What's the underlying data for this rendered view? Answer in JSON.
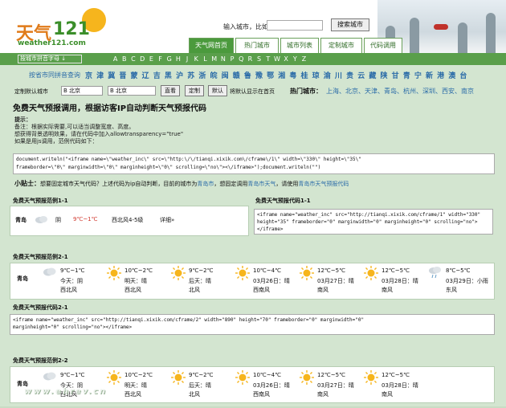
{
  "logo": {
    "cn": "天气",
    "num": "121",
    "url": "weather121.com"
  },
  "search": {
    "label": "输入城市，比如 北京",
    "button": "搜索城市"
  },
  "tabs": [
    "天气网首页",
    "热门城市",
    "城市列表",
    "定制城市",
    "代码调用"
  ],
  "letterbar": {
    "select_label": "按城市拼音字母 ↓",
    "letters": [
      "A",
      "B",
      "C",
      "D",
      "E",
      "F",
      "G",
      "H",
      "J",
      "K",
      "L",
      "M",
      "N",
      "P",
      "Q",
      "R",
      "S",
      "T",
      "W",
      "X",
      "Y",
      "Z"
    ]
  },
  "provinces": {
    "label": "按省市同拼音查询",
    "items": "京 津 冀 晋 蒙 辽 吉 黑 沪 苏 浙 皖 闽 赣 鲁 豫 鄂 湘 粤 桂 琼 渝 川 贵 云 藏 陕 甘 青 宁 新 港 澳 台"
  },
  "settings": {
    "label": "定制默认城市",
    "sel1": "B 北京",
    "sel2": "B 北京",
    "btn_go": "直看",
    "btn_custom": "定制",
    "btn_default": "默认",
    "note": "将默认显示在首页",
    "hot_label": "热门城市：",
    "hot_cities": "上海、北京、天津、青岛、杭州、深圳、西安、南京"
  },
  "main_title": "免费天气预报调用，根据访客IP自动判断天气预报代码",
  "tips": {
    "heading": "提示：",
    "line1": "备注：根据实际需要,可以适当调整宽度、高度。",
    "line2": "想获得背景透明效果，请在代码中加入allowtransparency=\"true\"",
    "line3": "如果是用js调用，范例代码如下："
  },
  "code_main": {
    "line1": "document.writeln(\"<iframe name=\\\"weather_inc\\\" src=\\\"http:\\/\\/tianqi.xixik.com\\/cframe\\/1\\\" width=\\\"330\\\" height=\\\"35\\\"",
    "line2": "frameborder=\\\"0\\\" marginwidth=\\\"0\\\" marginheight=\\\"0\\\" scrolling=\\\"no\\\"><\\/iframe>\");document.writeln(\"\")"
  },
  "small_tip": {
    "bold": "小贴士：",
    "text": "想要固定城市天气代码？上述代码为ip自动判断，目前的城市为",
    "city_link": "青岛市",
    "mid": "，想固定调用",
    "link2": "青岛市天气",
    "mid2": "，请使用",
    "link3": "青岛市天气预报代码"
  },
  "sec1": {
    "title": "免费天气预报范例1-1",
    "city": "青岛",
    "weather": "阴",
    "temp": "9℃~1℃",
    "wind": "西北风4-5级",
    "detail": "详细»"
  },
  "code1": {
    "title": "免费天气预报代码1-1",
    "text": "<iframe name=\"weather_inc\" src=\"http://tianqi.xixik.com/cframe/1\" width=\"330\" height=\"35\" frameborder=\"0\" marginwidth=\"0\" marginheight=\"0\" scrolling=\"no\"></iframe>"
  },
  "sec2": {
    "title": "免费天气预报范例2-1",
    "city": "青岛",
    "days": [
      {
        "temp": "9℃~1℃",
        "day": "今天：阴",
        "wind": "西北风"
      },
      {
        "temp": "10℃~2℃",
        "day": "明天：晴",
        "wind": "西北风"
      },
      {
        "temp": "9℃~2℃",
        "day": "后天：晴",
        "wind": "北风"
      },
      {
        "temp": "10℃~4℃",
        "day": "03月26日：晴",
        "wind": "西南风"
      },
      {
        "temp": "12℃~5℃",
        "day": "03月27日：晴",
        "wind": "南风"
      },
      {
        "temp": "12℃~5℃",
        "day": "03月28日：晴",
        "wind": "南风"
      },
      {
        "temp": "8℃~5℃",
        "day": "03月29日：小雨",
        "wind": "东风"
      }
    ]
  },
  "code2": {
    "title": "免费天气预报代码2-1",
    "line1": "<iframe name=\"weather_inc\" src=\"http://tianqi.xixik.com/cframe/2\" width=\"890\" height=\"70\" frameborder=\"0\" marginwidth=\"0\"",
    "line2": "marginheight=\"0\" scrolling=\"no\"></iframe>"
  },
  "sec3": {
    "title": "免费天气预报范例2-2",
    "city": "青岛",
    "days": [
      {
        "temp": "9℃~1℃",
        "day": "今天：阴",
        "wind": "西北风"
      },
      {
        "temp": "10℃~2℃",
        "day": "明天：晴",
        "wind": "西北风"
      },
      {
        "temp": "9℃~2℃",
        "day": "后天：晴",
        "wind": "北风"
      },
      {
        "temp": "10℃~4℃",
        "day": "03月26日：晴",
        "wind": "西南风"
      },
      {
        "temp": "12℃~5℃",
        "day": "03月27日：晴",
        "wind": "南风"
      },
      {
        "temp": "12℃~5℃",
        "day": "03月28日：晴",
        "wind": "南风"
      }
    ]
  },
  "watermark": "www.ehrev.cn",
  "colors": {
    "green": "#4b9a3d",
    "link": "#2a6ba8",
    "temp": "#d0352b",
    "sun": "#f6b51d"
  }
}
